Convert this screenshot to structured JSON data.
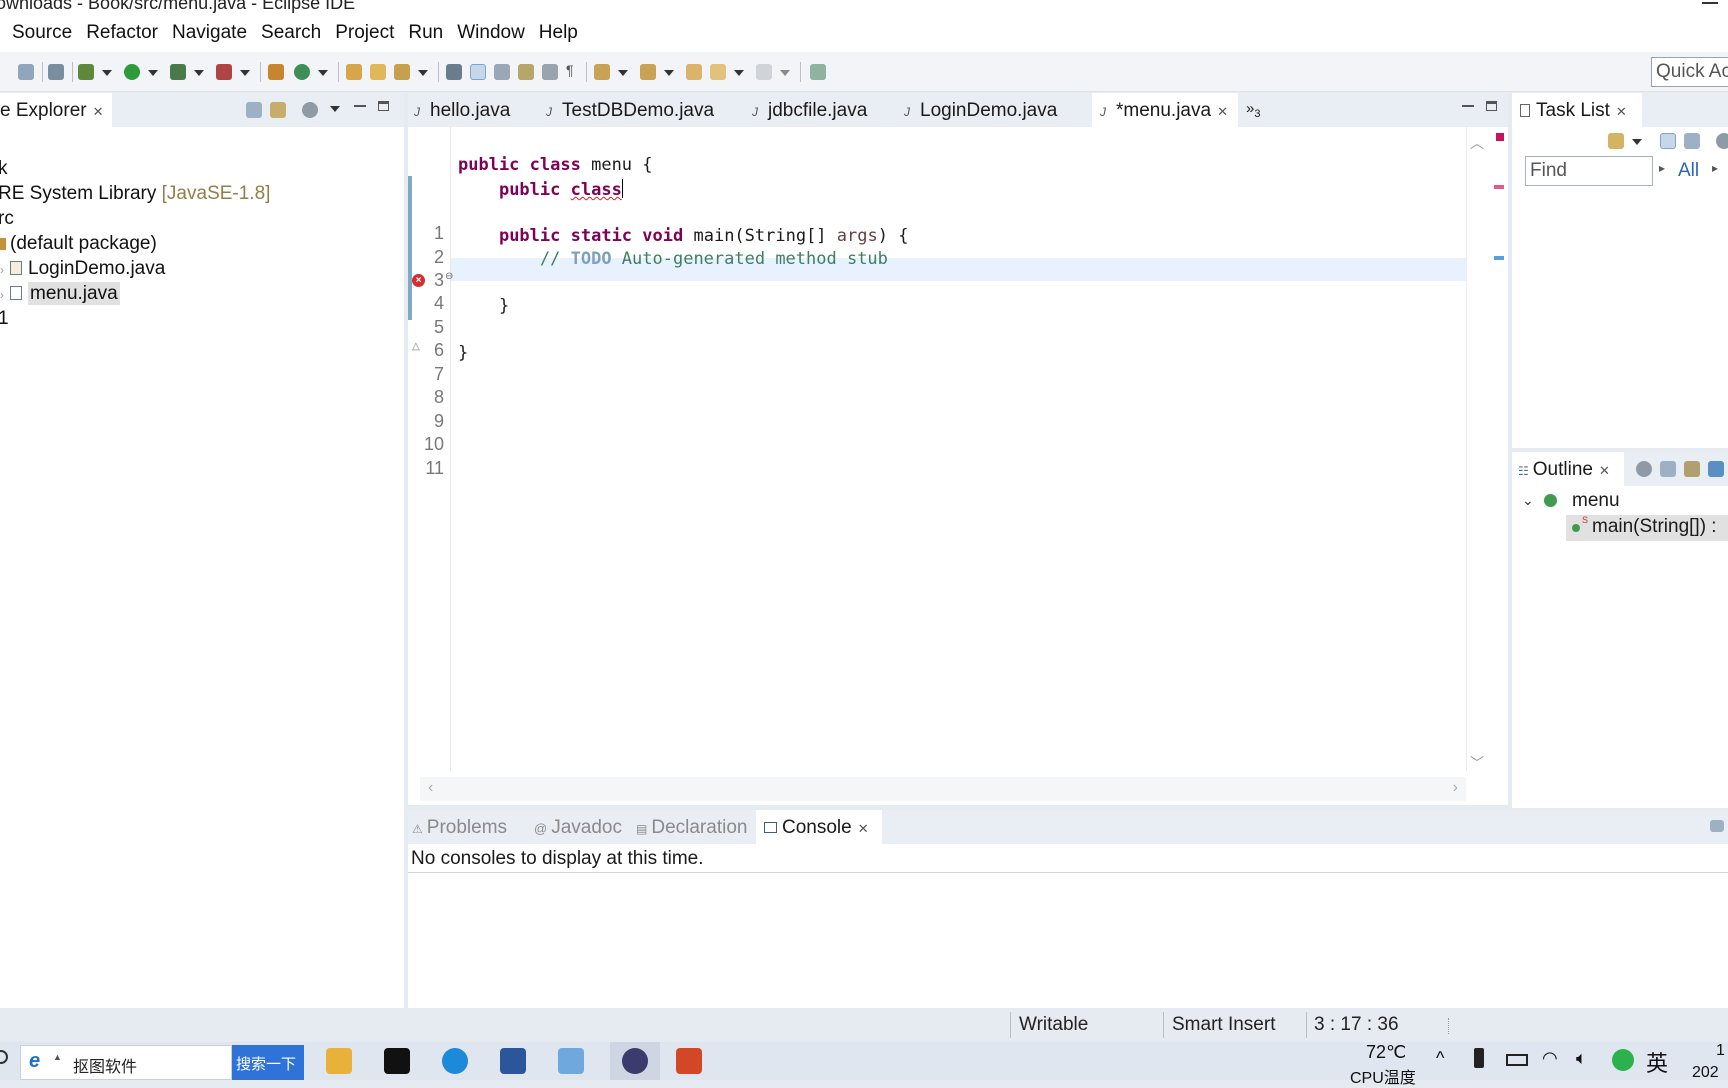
{
  "window": {
    "title": "ownloads - Book/src/menu.java - Eclipse IDE"
  },
  "menubar": {
    "items": [
      "Source",
      "Refactor",
      "Navigate",
      "Search",
      "Project",
      "Run",
      "Window",
      "Help"
    ]
  },
  "toolbar": {
    "quick_access_placeholder": "Quick Ac"
  },
  "package_explorer": {
    "tab_label": "e Explorer",
    "tree": [
      {
        "text": "k"
      },
      {
        "text": "RE System Library",
        "decoration": "[JavaSE-1.8]"
      },
      {
        "text": "rc"
      },
      {
        "text": "(default package)"
      },
      {
        "text": "LoginDemo.java"
      },
      {
        "text": "menu.java",
        "selected": true
      },
      {
        "text": "1"
      }
    ]
  },
  "editor": {
    "tabs": [
      {
        "label": "hello.java"
      },
      {
        "label": "TestDBDemo.java"
      },
      {
        "label": "jdbcfile.java"
      },
      {
        "label": "LoginDemo.java"
      },
      {
        "label": "*menu.java",
        "active": true
      }
    ],
    "overflow_label": "»",
    "overflow_count": "3",
    "line_numbers": [
      "1",
      "2",
      "3",
      "4",
      "5",
      "6",
      "7",
      "8",
      "9",
      "10",
      "11"
    ],
    "code": {
      "l2_kw1": "public",
      "l2_kw2": "class",
      "l2_rest": " menu {",
      "l3_kw1": "public",
      "l3_kw2": "class",
      "l5_kw1": "public",
      "l5_kw2": "static",
      "l5_kw3": "void",
      "l5_rest1": " main(String[] ",
      "l5_param": "args",
      "l5_rest2": ") {",
      "l6_c1": "// ",
      "l6_todo": "TODO",
      "l6_c2": " Auto-generated method stub",
      "l8": "}",
      "l10": "}"
    }
  },
  "task_list": {
    "tab_label": "Task List",
    "find_placeholder": "Find",
    "all_label": "All"
  },
  "outline": {
    "tab_label": "Outline",
    "class_name": "menu",
    "method": "main(String[]) :"
  },
  "bottom_panel": {
    "tabs": [
      {
        "label": "Problems"
      },
      {
        "label": "Javadoc"
      },
      {
        "label": "Declaration"
      },
      {
        "label": "Console",
        "active": true
      }
    ],
    "console_message": "No consoles to display at this time."
  },
  "status_bar": {
    "writable": "Writable",
    "insert_mode": "Smart Insert",
    "position": "3 : 17 : 36"
  },
  "taskbar": {
    "search_text": "抠图软件",
    "search_button": "搜索一下",
    "temperature": "72℃",
    "cpu_label": "CPU温度",
    "ime": "英",
    "clock_top": "1",
    "clock_bottom": "202"
  },
  "colors": {
    "keyword": "#7f0055",
    "comment": "#3f7f5f",
    "todo": "#7f9fbf",
    "error": "#d32f2f",
    "selection_bg": "#e1e1e1",
    "current_line_bg": "#e8f2fe"
  }
}
